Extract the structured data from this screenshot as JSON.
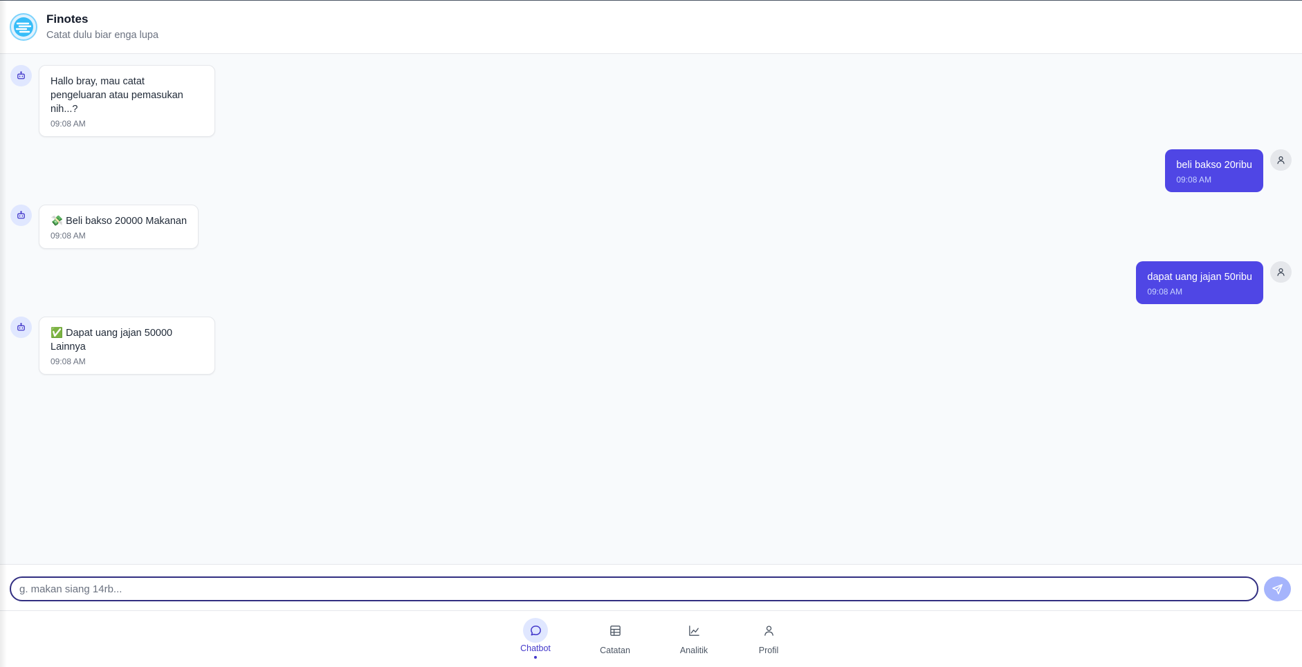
{
  "app": {
    "title": "Finotes",
    "subtitle": "Catat dulu biar enga lupa"
  },
  "messages": [
    {
      "sender": "bot",
      "text": "Hallo bray, mau catat\npengeluaran atau pemasukan\nnih...?",
      "time": "09:08 AM"
    },
    {
      "sender": "user",
      "text": "beli bakso 20ribu",
      "time": "09:08 AM"
    },
    {
      "sender": "bot",
      "emoji": "💸",
      "text": "Beli bakso 20000 Makanan",
      "time": "09:08 AM"
    },
    {
      "sender": "user",
      "text": "dapat uang jajan 50ribu",
      "time": "09:08 AM"
    },
    {
      "sender": "bot",
      "emoji": "✅",
      "text": "Dapat uang jajan 50000\nLainnya",
      "time": "09:08 AM"
    }
  ],
  "composer": {
    "placeholder": "g. makan siang 14rb...",
    "value": "",
    "send_icon": "send-icon"
  },
  "nav": {
    "items": [
      {
        "label": "Chatbot",
        "icon": "chat-bubble-icon",
        "active": true
      },
      {
        "label": "Catatan",
        "icon": "table-icon",
        "active": false
      },
      {
        "label": "Analitik",
        "icon": "line-chart-icon",
        "active": false
      },
      {
        "label": "Profil",
        "icon": "user-icon",
        "active": false
      }
    ]
  },
  "colors": {
    "accent": "#4f46e5",
    "accent_light": "#e0e7ff",
    "send_button": "#a5b4fc",
    "background": "#f8fafc"
  }
}
